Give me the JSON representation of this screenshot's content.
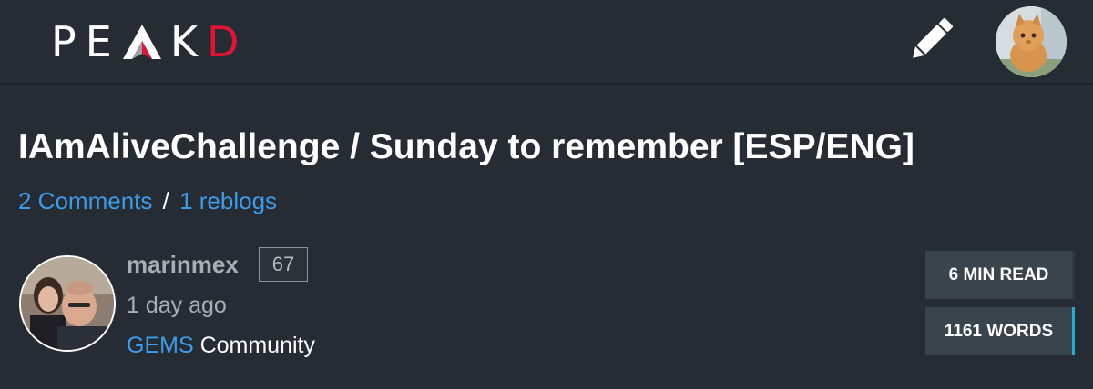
{
  "header": {
    "logo_letters_left": "PE",
    "logo_letters_right": "K",
    "logo_letter_accent": "D",
    "compose_icon": "pencil-icon",
    "avatar_icon": "user-avatar"
  },
  "post": {
    "title": "IAmAliveChallenge / Sunday to remember [ESP/ENG]",
    "comments_label": "2 Comments",
    "separator": "/",
    "reblogs_label": "1 reblogs"
  },
  "author": {
    "name": "marinmex",
    "reputation": "67",
    "time_ago": "1 day ago",
    "community_name": "GEMS",
    "community_suffix": "Community"
  },
  "stats": {
    "read_time": "6 MIN READ",
    "word_count": "1161 WORDS"
  },
  "colors": {
    "background": "#252c33",
    "link": "#3d9be9",
    "brand_red": "#e31337",
    "stat_box": "#39444d",
    "accent_cyan": "#26a9d6"
  }
}
